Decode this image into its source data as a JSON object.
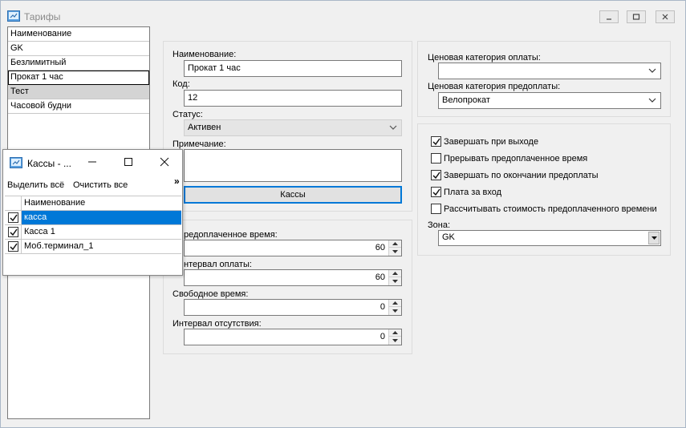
{
  "window": {
    "title": "Тарифы"
  },
  "tariff_list": {
    "header": "Наименование",
    "items": [
      "GK",
      "Безлимитный",
      "Прокат 1 час",
      "Тест",
      "Часовой будни"
    ],
    "selected_index": 3,
    "focused_index": 2
  },
  "form": {
    "name_label": "Наименование:",
    "name_value": "Прокат 1 час",
    "code_label": "Код:",
    "code_value": "12",
    "status_label": "Статус:",
    "status_value": "Активен",
    "note_label": "Примечание:",
    "note_value": "",
    "kassy_button": "Кассы"
  },
  "times": {
    "prepaid_label": "редоплаченное время:",
    "prepaid_value": "60",
    "interval_label": "нтервал оплаты:",
    "interval_value": "60",
    "free_label": "Свободное время:",
    "free_value": "0",
    "absence_label": "Интервал отсутствия:",
    "absence_value": "0"
  },
  "price": {
    "pay_cat_label": "Ценовая категория оплаты:",
    "pay_cat_value": "",
    "prepay_cat_label": "Ценовая категория предоплаты:",
    "prepay_cat_value": "Велопрокат"
  },
  "options": {
    "items": [
      {
        "label": "Завершать при выходе",
        "checked": true
      },
      {
        "label": "Прерывать предоплаченное время",
        "checked": false
      },
      {
        "label": "Завершать по окончании предоплаты",
        "checked": true
      },
      {
        "label": "Плата за вход",
        "checked": true
      },
      {
        "label": "Рассчитывать стоимость предоплаченного времени",
        "checked": false
      }
    ],
    "zone_label": "Зона:",
    "zone_value": "GK"
  },
  "popup": {
    "title": "Кассы - ...",
    "select_all": "Выделить всё",
    "clear_all": "Очистить все",
    "overflow": "»",
    "column_header": "Наименование",
    "rows": [
      {
        "name": "касса",
        "checked": true,
        "selected": true
      },
      {
        "name": "Касса 1",
        "checked": true,
        "selected": false
      },
      {
        "name": "Моб.терминал_1",
        "checked": true,
        "selected": false
      }
    ]
  },
  "colors": {
    "selection": "#0078d7",
    "window_bg": "#f0f0f0"
  }
}
